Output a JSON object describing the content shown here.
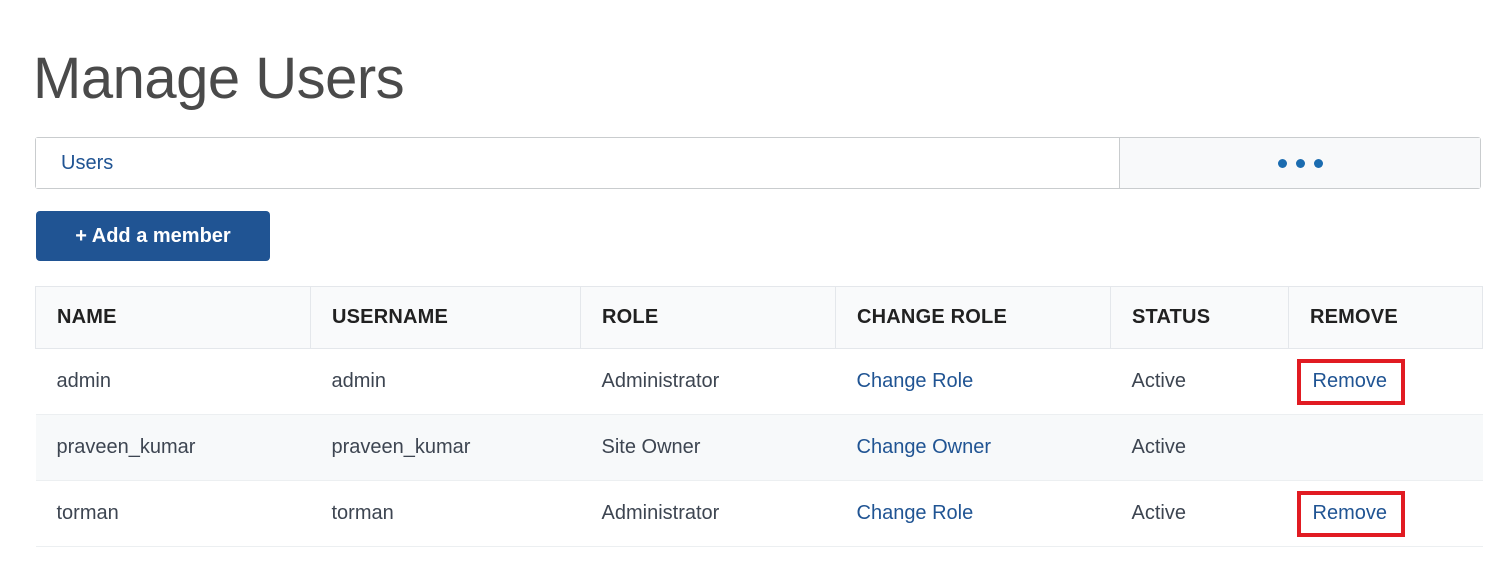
{
  "page": {
    "title": "Manage Users"
  },
  "tabs": {
    "users_label": "Users",
    "more_label": "•••",
    "more_icon": "ellipsis-icon"
  },
  "toolbar": {
    "add_member_label": "+ Add a member"
  },
  "table": {
    "columns": [
      "NAME",
      "USERNAME",
      "ROLE",
      "CHANGE ROLE",
      "STATUS",
      "REMOVE"
    ],
    "rows": [
      {
        "name": "admin",
        "username": "admin",
        "role": "Administrator",
        "change_role": "Change Role",
        "status": "Active",
        "remove": "Remove",
        "highlighted": true
      },
      {
        "name": "praveen_kumar",
        "username": "praveen_kumar",
        "role": "Site Owner",
        "change_role": "Change Owner",
        "status": "Active",
        "remove": "",
        "highlighted": false
      },
      {
        "name": "torman",
        "username": "torman",
        "role": "Administrator",
        "change_role": "Change Role",
        "status": "Active",
        "remove": "Remove",
        "highlighted": true
      }
    ]
  },
  "colors": {
    "link": "#205493",
    "button": "#205493",
    "annotation": "#e11b22",
    "title_text": "#4a4a4a",
    "row_stripe": "#f7f9fa",
    "header_bg": "#f9fafb"
  }
}
